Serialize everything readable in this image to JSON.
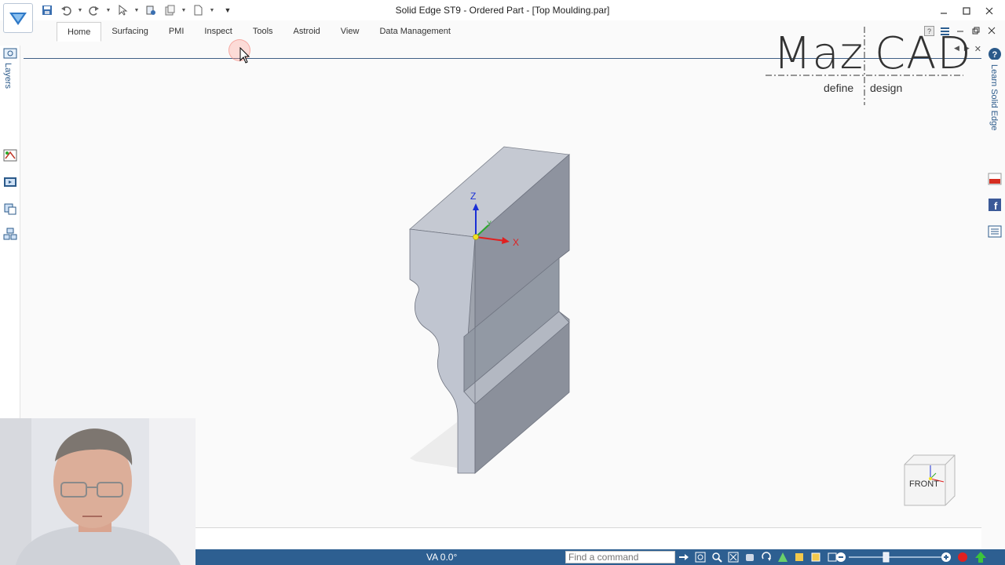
{
  "window": {
    "title": "Solid Edge ST9 - Ordered Part - [Top Moulding.par]",
    "controls": [
      "minimize",
      "maximize",
      "close"
    ]
  },
  "quick_access": {
    "items": [
      "save-icon",
      "undo-icon",
      "redo-icon",
      "select-icon",
      "properties-icon",
      "paste-icon",
      "new-document-icon",
      "customize-icon"
    ]
  },
  "ribbon": {
    "tabs": [
      "Home",
      "Surfacing",
      "PMI",
      "Inspect",
      "Tools",
      "Astroid",
      "View",
      "Data Management"
    ],
    "active_tab": "Home"
  },
  "left_panel": {
    "tab_label": "Layers"
  },
  "right_panel": {
    "tab_label": "Learn Solid Edge"
  },
  "logo": {
    "brand": "MazCAD",
    "brand_left": "Maz",
    "brand_right": "CAD",
    "tag_left": "define",
    "tag_right": "design"
  },
  "viewport": {
    "axis_labels": {
      "z": "Z",
      "x": "X",
      "y": "Y"
    },
    "view_cube_face": "FRONT"
  },
  "statusbar": {
    "view_angle": "VA 0.0°",
    "find_placeholder": "Find a command"
  },
  "colors": {
    "statusbar": "#2d5f91",
    "model_face_light": "#c5c9d2",
    "model_face_mid": "#a9aeb9",
    "model_face_dark": "#8e939f",
    "axis_x": "#e02020",
    "axis_z": "#1a2fd6",
    "axis_y": "#2ba82b"
  }
}
